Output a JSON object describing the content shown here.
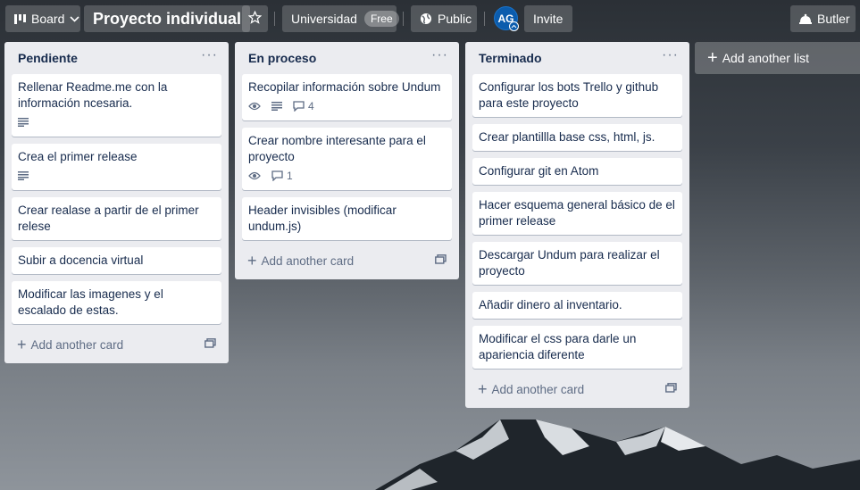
{
  "header": {
    "board_switcher_label": "Board",
    "board_title": "Proyecto individual",
    "workspace_label": "Universidad",
    "workspace_badge": "Free",
    "visibility_label": "Public",
    "avatar_initials": "AG",
    "invite_label": "Invite",
    "butler_label": "Butler"
  },
  "lists": [
    {
      "title": "Pendiente",
      "menu": "···",
      "cards": [
        {
          "title": "Rellenar Readme.me con la información ncesaria.",
          "description": true
        },
        {
          "title": "Crea el primer release",
          "description": true
        },
        {
          "title": "Crear realase a partir de el primer relese"
        },
        {
          "title": "Subir a docencia virtual"
        },
        {
          "title": "Modificar las imagenes y el escalado de estas."
        }
      ],
      "add_card_label": "Add another card"
    },
    {
      "title": "En proceso",
      "menu": "···",
      "cards": [
        {
          "title": "Recopilar información sobre Undum",
          "watch": true,
          "description": true,
          "comments": "4"
        },
        {
          "title": "Crear nombre interesante para el proyecto",
          "watch": true,
          "comments": "1"
        },
        {
          "title": "Header invisibles (modificar undum.js)"
        }
      ],
      "add_card_label": "Add another card"
    },
    {
      "title": "Terminado",
      "menu": "···",
      "cards": [
        {
          "title": "Configurar los bots Trello y github para este proyecto"
        },
        {
          "title": "Crear plantillla base css, html, js."
        },
        {
          "title": "Configurar git en Atom"
        },
        {
          "title": "Hacer esquema general básico de el primer release"
        },
        {
          "title": "Descargar Undum para realizar el proyecto"
        },
        {
          "title": "Añadir dinero al inventario."
        },
        {
          "title": "Modificar el css para darle un apariencia diferente"
        }
      ],
      "add_card_label": "Add another card"
    }
  ],
  "add_list_label": "Add another list",
  "icons": {
    "board": "board-icon",
    "chevron": "chevron-down-icon",
    "star": "star-icon",
    "globe": "globe-icon",
    "butler": "butler-icon",
    "description": "description-icon",
    "watch": "eye-icon",
    "comment": "comment-icon",
    "template": "card-template-icon"
  },
  "colors": {
    "list_bg": "#ebecf0",
    "card_bg": "#ffffff",
    "text": "#172b4d",
    "muted": "#5e6c84",
    "avatar": "#0b5cad"
  }
}
